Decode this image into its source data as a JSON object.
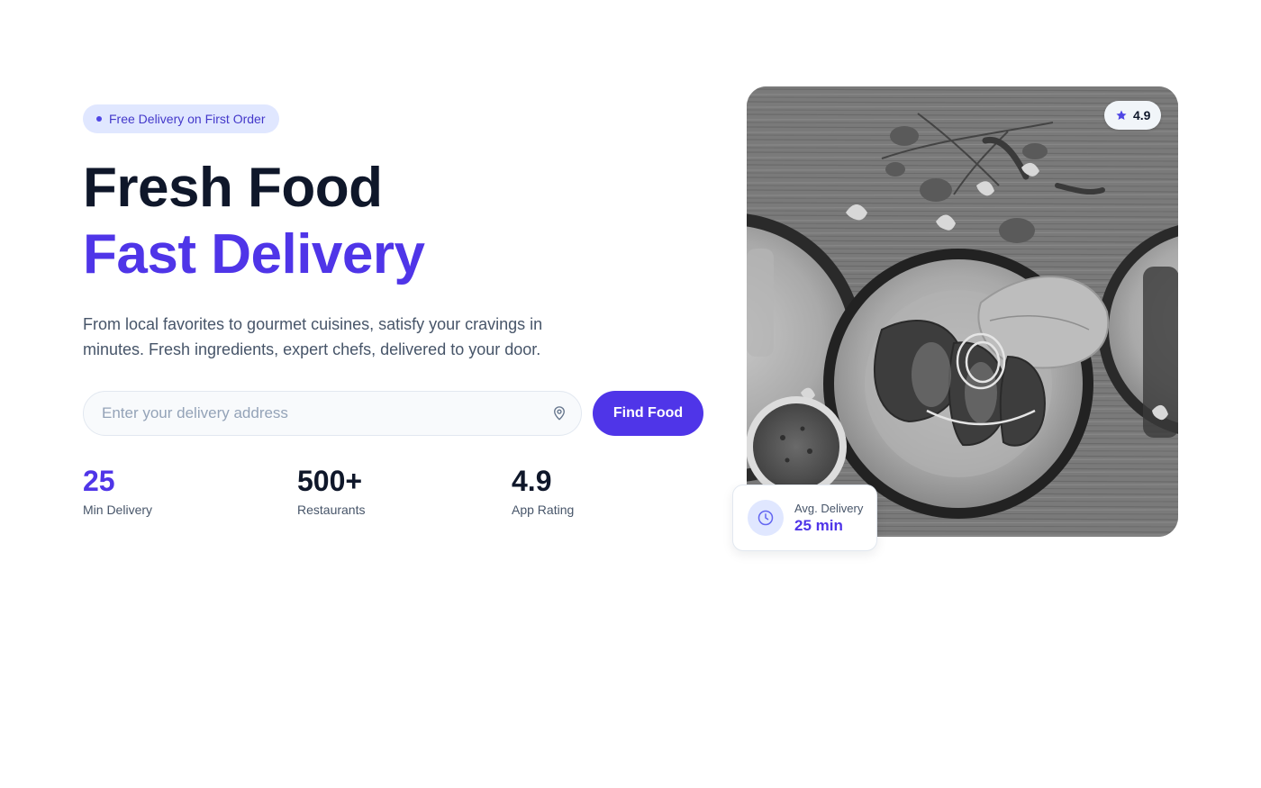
{
  "hero": {
    "badge": "Free Delivery on First Order",
    "headline_line1": "Fresh Food",
    "headline_line2": "Fast Delivery",
    "description": "From local favorites to gourmet cuisines, satisfy your cravings in minutes. Fresh ingredients, expert chefs, delivered to your door.",
    "search": {
      "placeholder": "Enter your delivery address",
      "value": "",
      "icon": "map-pin-icon"
    },
    "cta_label": "Find Food",
    "stats": [
      {
        "value": "25",
        "label": "Min Delivery",
        "color": "#4f35e8"
      },
      {
        "value": "500+",
        "label": "Restaurants",
        "color": "#0f172a"
      },
      {
        "value": "4.9",
        "label": "App Rating",
        "color": "#0f172a"
      }
    ]
  },
  "image": {
    "rating": "4.9",
    "rating_icon": "star-icon"
  },
  "delivery_card": {
    "icon": "clock-icon",
    "label": "Avg. Delivery",
    "value": "25 min"
  },
  "colors": {
    "accent": "#4f35e8",
    "badge_bg": "#e0e7ff",
    "badge_text": "#4338ca",
    "heading": "#0f172a",
    "body_text": "#475569"
  }
}
